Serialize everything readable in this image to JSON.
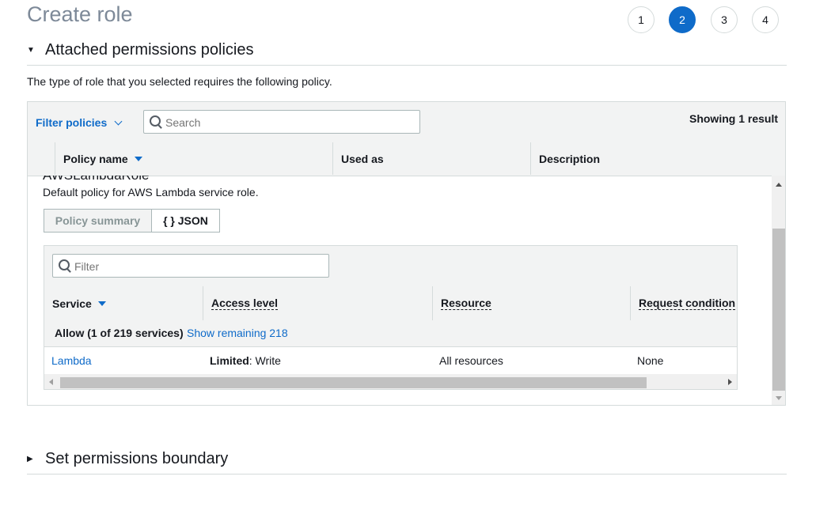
{
  "page": {
    "title": "Create role"
  },
  "steps": [
    {
      "label": "1",
      "active": false
    },
    {
      "label": "2",
      "active": true
    },
    {
      "label": "3",
      "active": false
    },
    {
      "label": "4",
      "active": false
    }
  ],
  "attached_section": {
    "title": "Attached permissions policies",
    "description": "The type of role that you selected requires the following policy."
  },
  "policies_table": {
    "filter_label": "Filter policies",
    "search_placeholder": "Search",
    "result_count": "Showing 1 result",
    "columns": [
      "Policy name",
      "Used as",
      "Description"
    ]
  },
  "policy_detail": {
    "name": "AWSLambdaRole",
    "description": "Default policy for AWS Lambda service role.",
    "tabs": [
      "Policy summary",
      "{ } JSON"
    ],
    "active_tab": "Policy summary",
    "filter_placeholder": "Filter",
    "columns": [
      "Service",
      "Access level",
      "Resource",
      "Request condition"
    ],
    "allow_summary": "Allow (1 of 219 services)",
    "show_remaining": "Show remaining 218",
    "rows": [
      {
        "service": "Lambda",
        "access_bold": "Limited",
        "access_rest": ": Write",
        "resource": "All resources",
        "condition": "None"
      }
    ]
  },
  "boundary_section": {
    "title": "Set permissions boundary"
  },
  "colors": {
    "accent": "#0f6bc9",
    "border": "#d5dbdb",
    "header_bg": "#f2f3f3"
  }
}
